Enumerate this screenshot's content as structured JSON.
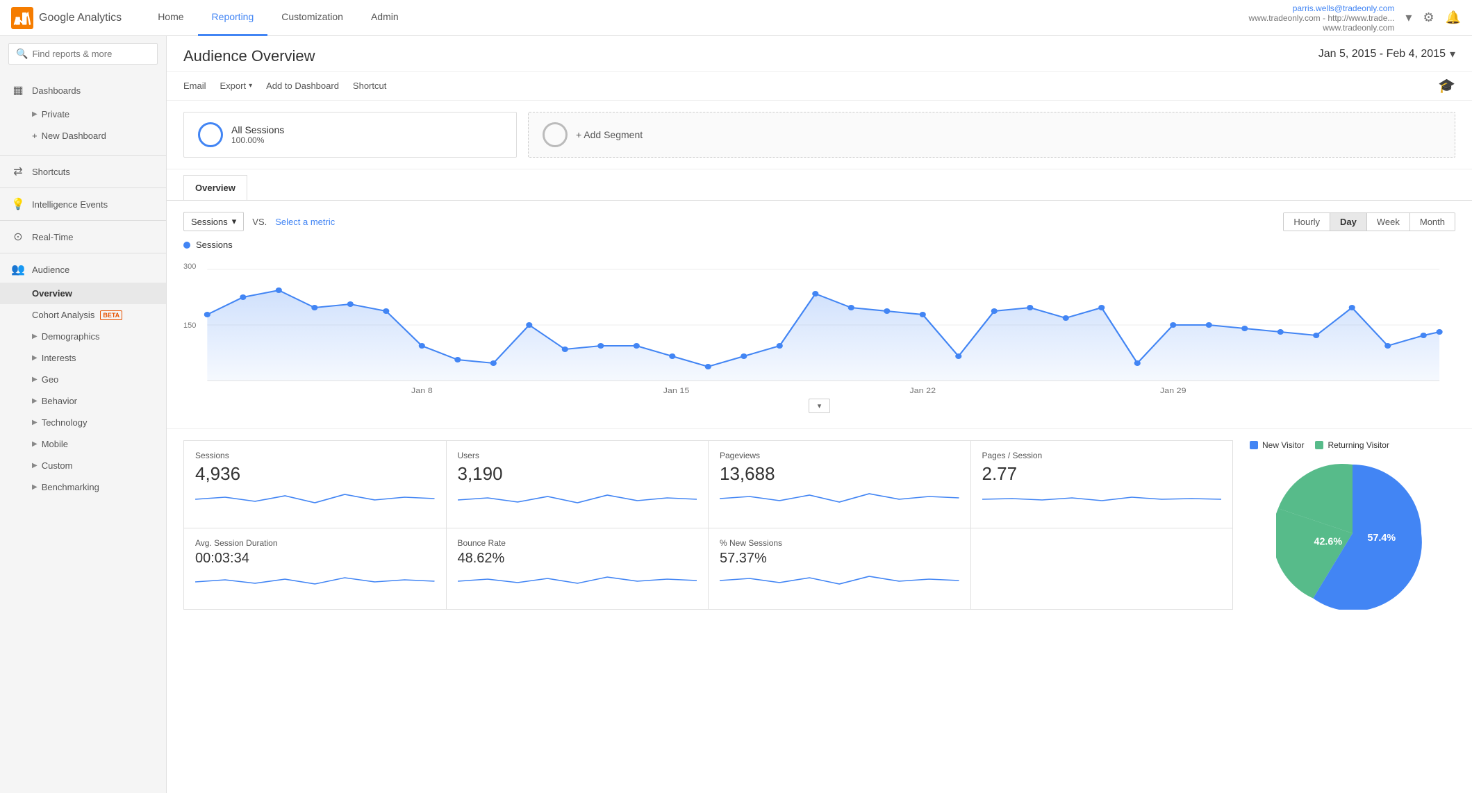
{
  "brand": {
    "name": "Google Analytics"
  },
  "topnav": {
    "links": [
      {
        "label": "Home",
        "active": false
      },
      {
        "label": "Reporting",
        "active": true
      },
      {
        "label": "Customization",
        "active": false
      },
      {
        "label": "Admin",
        "active": false
      }
    ],
    "user": {
      "email": "parris.wells@tradeonly.com",
      "domain1": "www.tradeonly.com - http://www.trade...",
      "domain2": "www.tradeonly.com"
    }
  },
  "sidebar": {
    "search_placeholder": "Find reports & more",
    "items": [
      {
        "label": "Dashboards",
        "icon": "▦",
        "id": "dashboards"
      },
      {
        "label": "Private",
        "sub": true,
        "chevron": true
      },
      {
        "label": "New Dashboard",
        "sub": true,
        "add": true
      },
      {
        "label": "Shortcuts",
        "icon": "←→",
        "id": "shortcuts"
      },
      {
        "label": "Intelligence Events",
        "icon": "💡",
        "id": "intelligence"
      },
      {
        "label": "Real-Time",
        "icon": "🕐",
        "id": "realtime"
      },
      {
        "label": "Audience",
        "icon": "👥",
        "id": "audience"
      },
      {
        "label": "Overview",
        "sub": true,
        "active": true
      },
      {
        "label": "Cohort Analysis",
        "sub": true,
        "beta": true
      },
      {
        "label": "Demographics",
        "sub": true,
        "chevron": true
      },
      {
        "label": "Interests",
        "sub": true,
        "chevron": true
      },
      {
        "label": "Geo",
        "sub": true,
        "chevron": true
      },
      {
        "label": "Behavior",
        "sub": true,
        "chevron": true
      },
      {
        "label": "Technology",
        "sub": true,
        "chevron": true
      },
      {
        "label": "Mobile",
        "sub": true,
        "chevron": true
      },
      {
        "label": "Custom",
        "sub": true,
        "chevron": true
      },
      {
        "label": "Benchmarking",
        "sub": true,
        "chevron": true
      }
    ],
    "beta_label": "BETA"
  },
  "header": {
    "title": "Audience Overview",
    "date_range": "Jan 5, 2015 - Feb 4, 2015"
  },
  "action_bar": {
    "email": "Email",
    "export": "Export",
    "add_to_dashboard": "Add to Dashboard",
    "shortcut": "Shortcut"
  },
  "segments": {
    "all_sessions": {
      "label": "All Sessions",
      "percent": "100.00%"
    },
    "add_segment": {
      "label": "+ Add Segment"
    }
  },
  "overview_tab": "Overview",
  "chart": {
    "metric_dropdown": "Sessions",
    "vs_label": "VS.",
    "select_metric": "Select a metric",
    "time_buttons": [
      "Hourly",
      "Day",
      "Week",
      "Month"
    ],
    "active_time": "Day",
    "legend_label": "Sessions",
    "y_labels": [
      "300",
      "150"
    ],
    "x_labels": [
      "Jan 8",
      "Jan 15",
      "Jan 22",
      "Jan 29"
    ]
  },
  "metrics": [
    {
      "label": "Sessions",
      "value": "4,936"
    },
    {
      "label": "Users",
      "value": "3,190"
    },
    {
      "label": "Pageviews",
      "value": "13,688"
    },
    {
      "label": "Pages / Session",
      "value": "2.77"
    },
    {
      "label": "Avg. Session Duration",
      "value": "00:03:34"
    },
    {
      "label": "Bounce Rate",
      "value": "48.62%"
    },
    {
      "label": "% New Sessions",
      "value": "57.37%"
    }
  ],
  "pie": {
    "new_visitor_label": "New Visitor",
    "returning_visitor_label": "Returning Visitor",
    "new_pct": 57.4,
    "returning_pct": 42.6,
    "new_label": "57.4%",
    "returning_label": "42.6%"
  }
}
